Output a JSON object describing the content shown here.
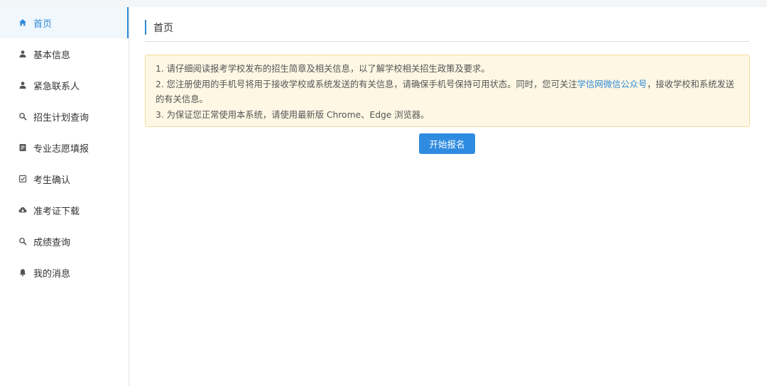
{
  "sidebar": {
    "items": [
      {
        "label": "首页",
        "icon": "home-icon",
        "active": true
      },
      {
        "label": "基本信息",
        "icon": "user-icon",
        "active": false
      },
      {
        "label": "紧急联系人",
        "icon": "user-icon",
        "active": false
      },
      {
        "label": "招生计划查询",
        "icon": "search-icon",
        "active": false
      },
      {
        "label": "专业志愿填报",
        "icon": "form-icon",
        "active": false
      },
      {
        "label": "考生确认",
        "icon": "checkbox-icon",
        "active": false
      },
      {
        "label": "准考证下载",
        "icon": "cloud-download-icon",
        "active": false
      },
      {
        "label": "成绩查询",
        "icon": "search-icon",
        "active": false
      },
      {
        "label": "我的消息",
        "icon": "bell-icon",
        "active": false
      }
    ]
  },
  "main": {
    "title": "首页",
    "notice": {
      "line1": "1. 请仔细阅读报考学校发布的招生简章及相关信息，以了解学校相关招生政策及要求。",
      "line2_before": "2. 您注册使用的手机号将用于接收学校或系统发送的有关信息，请确保手机号保持可用状态。同时，您可关注",
      "line2_link": "学信网微信公众号",
      "line2_after": "，接收学校和系统发送的有关信息。",
      "line3": "3. 为保证您正常使用本系统，请使用最新版 Chrome、Edge 浏览器。"
    },
    "start_button": "开始报名"
  },
  "colors": {
    "accent": "#2f8bd8",
    "notice_bg": "#fef7e4",
    "notice_border": "#f5dc9c",
    "button_bg": "#2f8be0"
  }
}
